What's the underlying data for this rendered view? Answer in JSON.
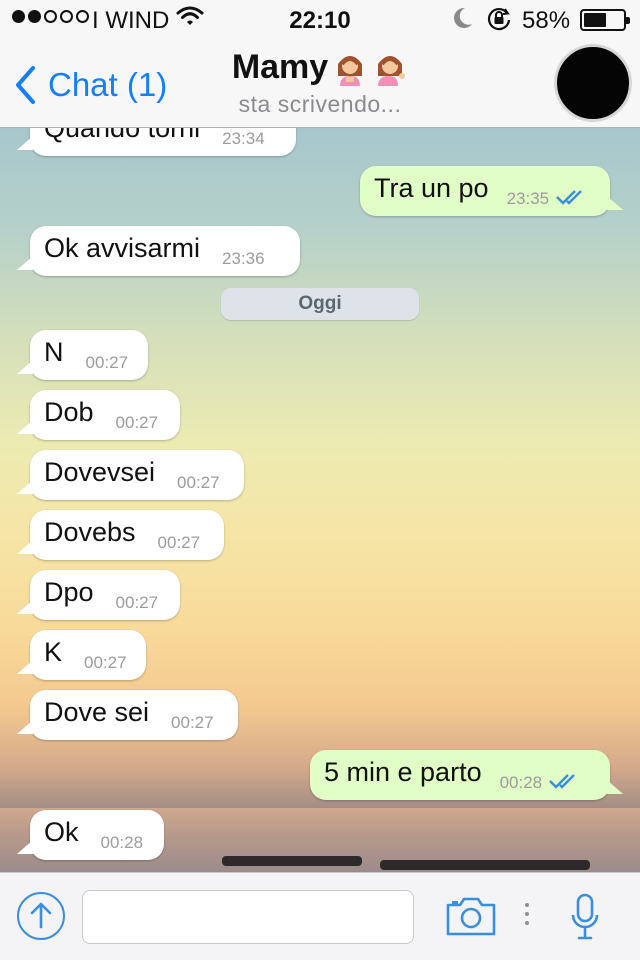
{
  "status_bar": {
    "carrier": "I WIND",
    "time": "22:10",
    "battery_percent": "58%",
    "battery_level": 0.58,
    "signal_bars_filled": 2,
    "signal_bars_total": 5
  },
  "header": {
    "back_label": "Chat (1)",
    "contact_name": "Mamy",
    "status": "sta scrivendo..."
  },
  "messages": [
    {
      "dir": "in",
      "text": "Quando torni",
      "time": "23:34"
    },
    {
      "dir": "out",
      "text": "Tra un po",
      "time": "23:35",
      "read": true
    },
    {
      "dir": "in",
      "text": "Ok  avvisarmi",
      "time": "23:36"
    },
    {
      "dir": "in",
      "text": "N",
      "time": "00:27"
    },
    {
      "dir": "in",
      "text": "Dob",
      "time": "00:27"
    },
    {
      "dir": "in",
      "text": "Dovevsei",
      "time": "00:27"
    },
    {
      "dir": "in",
      "text": "Dovebs",
      "time": "00:27"
    },
    {
      "dir": "in",
      "text": "Dpo",
      "time": "00:27"
    },
    {
      "dir": "in",
      "text": "K",
      "time": "00:27"
    },
    {
      "dir": "in",
      "text": "Dove sei",
      "time": "00:27"
    },
    {
      "dir": "out",
      "text": "5 min e parto",
      "time": "00:28",
      "read": true
    },
    {
      "dir": "in",
      "text": "Ok",
      "time": "00:28"
    }
  ],
  "date_separator": "Oggi",
  "input": {
    "value": "",
    "placeholder": ""
  },
  "icons": {
    "back": "chevron-left-icon",
    "upload": "upload-arrow-icon",
    "camera": "camera-icon",
    "mic": "microphone-icon",
    "wifi": "wifi-icon",
    "moon": "do-not-disturb-moon-icon",
    "rotation_lock": "rotation-lock-icon",
    "read_ticks": "double-check-icon"
  },
  "colors": {
    "accent": "#157efb",
    "ticks": "#3a8ee0",
    "incoming_bubble": "#ffffff",
    "outgoing_bubble": "#e1fec6"
  }
}
